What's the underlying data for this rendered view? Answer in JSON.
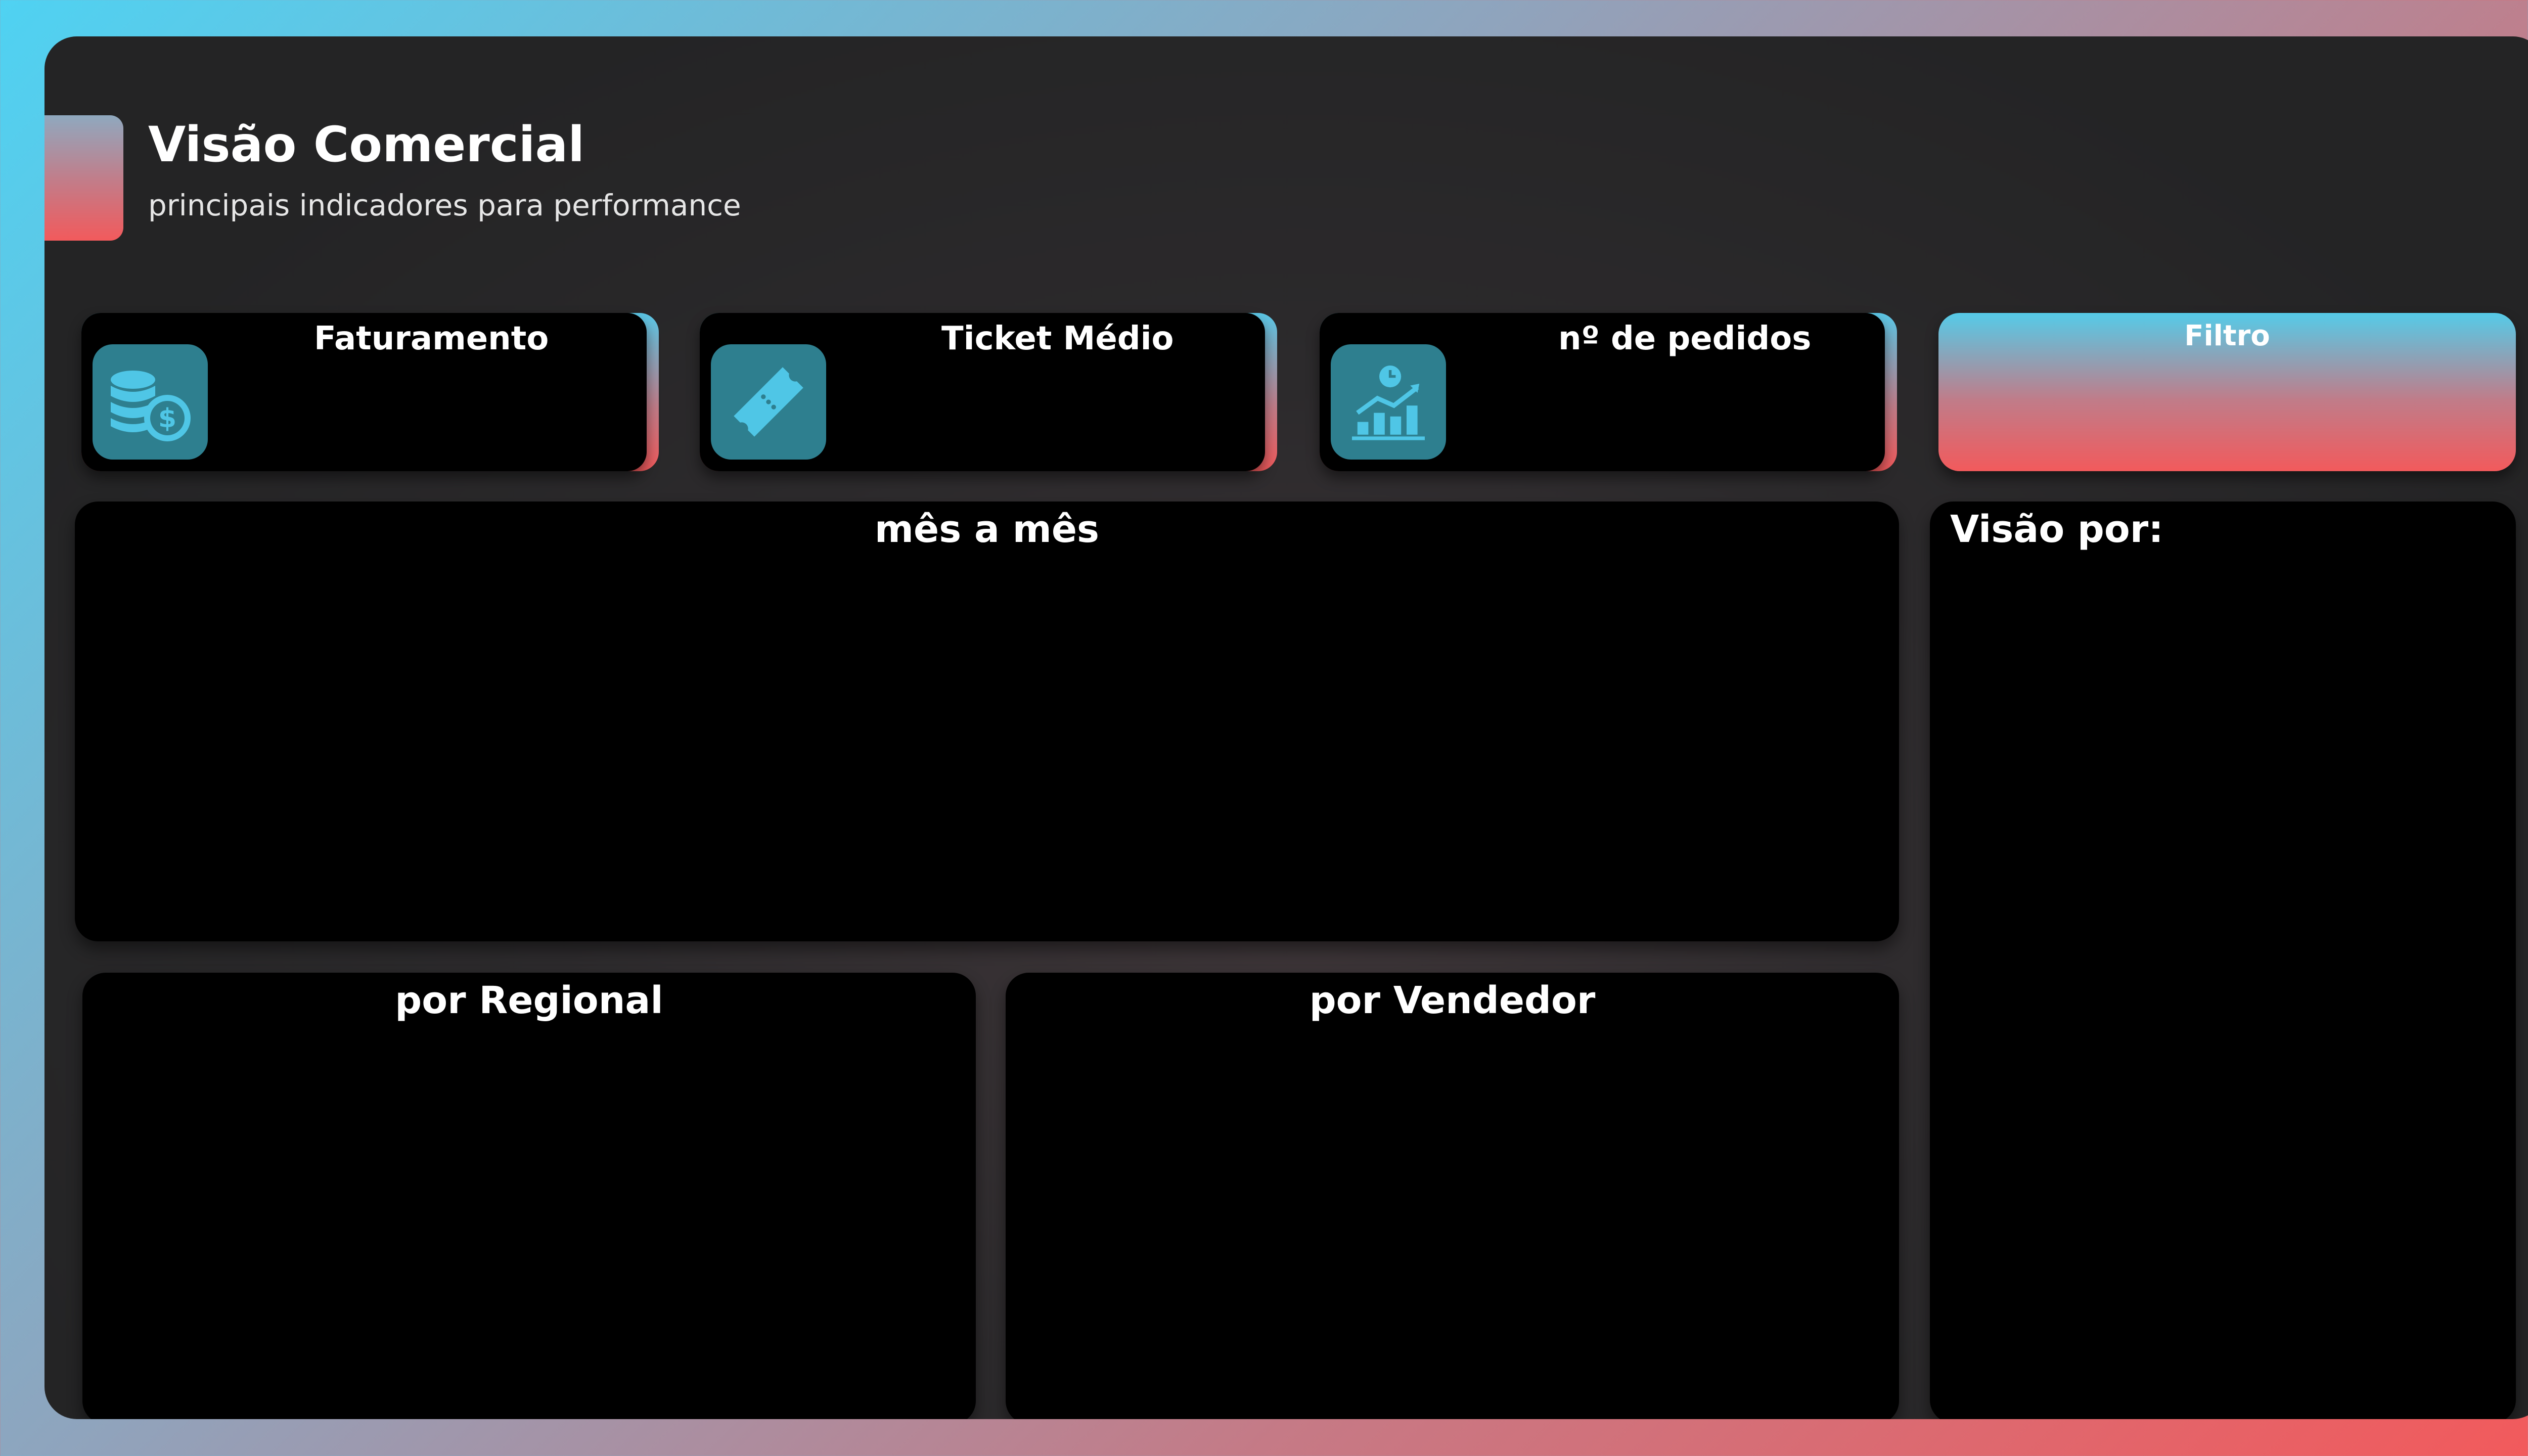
{
  "header": {
    "title": "Visão Comercial",
    "subtitle": "principais indicadores para performance"
  },
  "kpis": [
    {
      "label": "Faturamento",
      "icon": "coins-dollar-icon"
    },
    {
      "label": "Ticket Médio",
      "icon": "ticket-icon"
    },
    {
      "label": "nº de pedidos",
      "icon": "growth-chart-icon"
    }
  ],
  "filter": {
    "label": "Filtro"
  },
  "panels": {
    "monthly": "mês a mês",
    "view_by": "Visão por:",
    "regional": "por Regional",
    "seller": "por Vendedor"
  },
  "colors": {
    "gradient_start": "#4fd2f2",
    "gradient_end": "#f25a5c",
    "card_bg": "#000000",
    "icon_tile": "#2e7f8f",
    "icon_glyph": "#4fc6e6"
  }
}
